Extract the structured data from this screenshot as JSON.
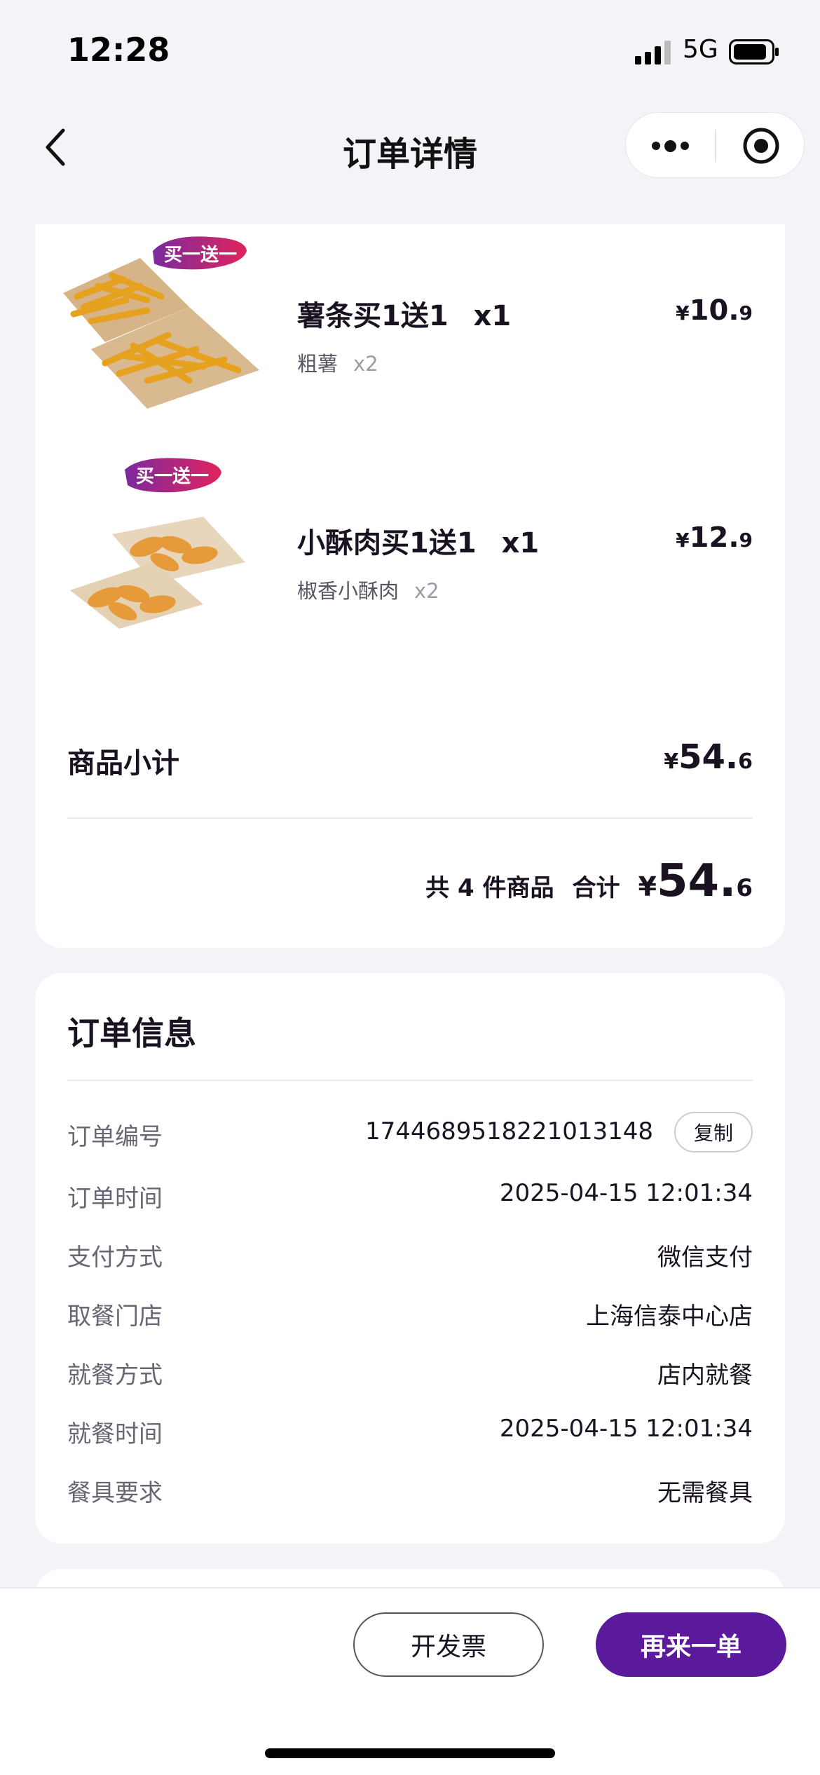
{
  "status_bar": {
    "time": "12:28",
    "network": "5G"
  },
  "nav": {
    "title": "订单详情"
  },
  "colors": {
    "brand": "#5a1a9b",
    "background": "#f4f3f8",
    "card": "#ffffff",
    "promo_from": "#7a2a9e",
    "promo_to": "#e0245e"
  },
  "products": [
    {
      "name": "薯条买1送1",
      "qty": "x1",
      "sub_item": "粗薯",
      "sub_qty": "x2",
      "price_currency": "¥",
      "price_int": "10.",
      "price_dec": "9",
      "badge": "买一送一"
    },
    {
      "name": "小酥肉买1送1",
      "qty": "x1",
      "sub_item": "椒香小酥肉",
      "sub_qty": "x2",
      "price_currency": "¥",
      "price_int": "12.",
      "price_dec": "9",
      "badge": "买一送一"
    }
  ],
  "subtotal": {
    "label": "商品小计",
    "currency": "¥",
    "int": "54.",
    "dec": "6"
  },
  "total": {
    "count_text": "共 4 件商品",
    "label": "合计",
    "currency": "¥",
    "int": "54.",
    "dec": "6"
  },
  "order_info": {
    "title": "订单信息",
    "copy_label": "复制",
    "rows": [
      {
        "label": "订单编号",
        "value": "1744689518221013148"
      },
      {
        "label": "订单时间",
        "value": "2025-04-15 12:01:34"
      },
      {
        "label": "支付方式",
        "value": "微信支付"
      },
      {
        "label": "取餐门店",
        "value": "上海信泰中心店"
      },
      {
        "label": "就餐方式",
        "value": "店内就餐"
      },
      {
        "label": "就餐时间",
        "value": "2025-04-15 12:01:34"
      },
      {
        "label": "餐具要求",
        "value": "无需餐具"
      }
    ]
  },
  "actions": {
    "invoice_label": "开发票",
    "reorder_label": "再来一单"
  },
  "icons": {
    "back": "chevron-left-icon",
    "more": "more-dots-icon",
    "close": "target-close-icon",
    "signal": "signal-bars-icon",
    "battery": "battery-icon"
  }
}
